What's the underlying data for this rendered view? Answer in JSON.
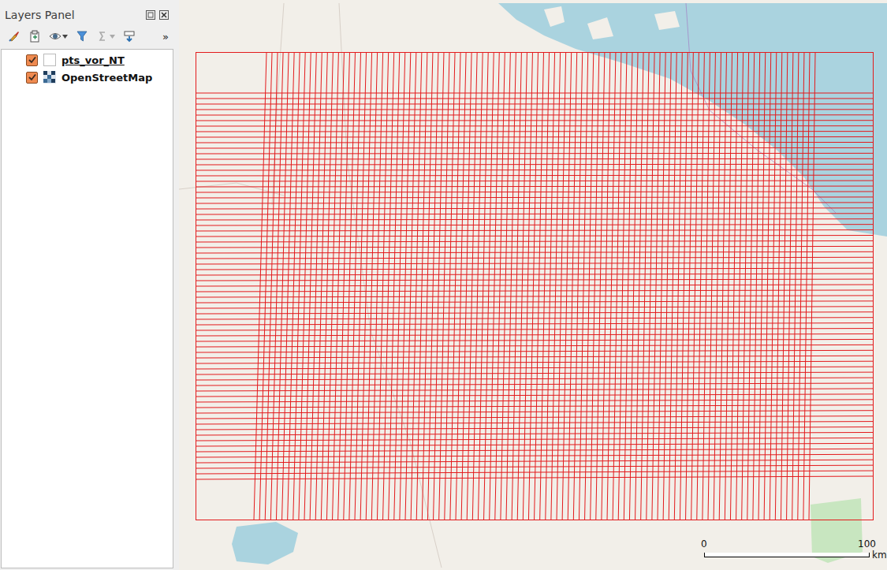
{
  "panel": {
    "title": "Layers Panel",
    "toolbar": [
      {
        "kind": "style",
        "disabled": false,
        "dropdown": false
      },
      {
        "kind": "add-group",
        "disabled": false,
        "dropdown": false
      },
      {
        "kind": "visibility",
        "disabled": false,
        "dropdown": true
      },
      {
        "kind": "filter",
        "disabled": false,
        "dropdown": false
      },
      {
        "kind": "expression",
        "disabled": true,
        "dropdown": true
      },
      {
        "kind": "expand",
        "disabled": false,
        "dropdown": false
      }
    ],
    "overflow": "»"
  },
  "layers": [
    {
      "name": "pts_vor_NT",
      "checked": true,
      "selected": true,
      "kind": "vector"
    },
    {
      "name": "OpenStreetMap",
      "checked": true,
      "selected": false,
      "kind": "raster"
    }
  ],
  "scale_bar": {
    "ticks": [
      "0",
      "100"
    ],
    "unit": "km"
  }
}
